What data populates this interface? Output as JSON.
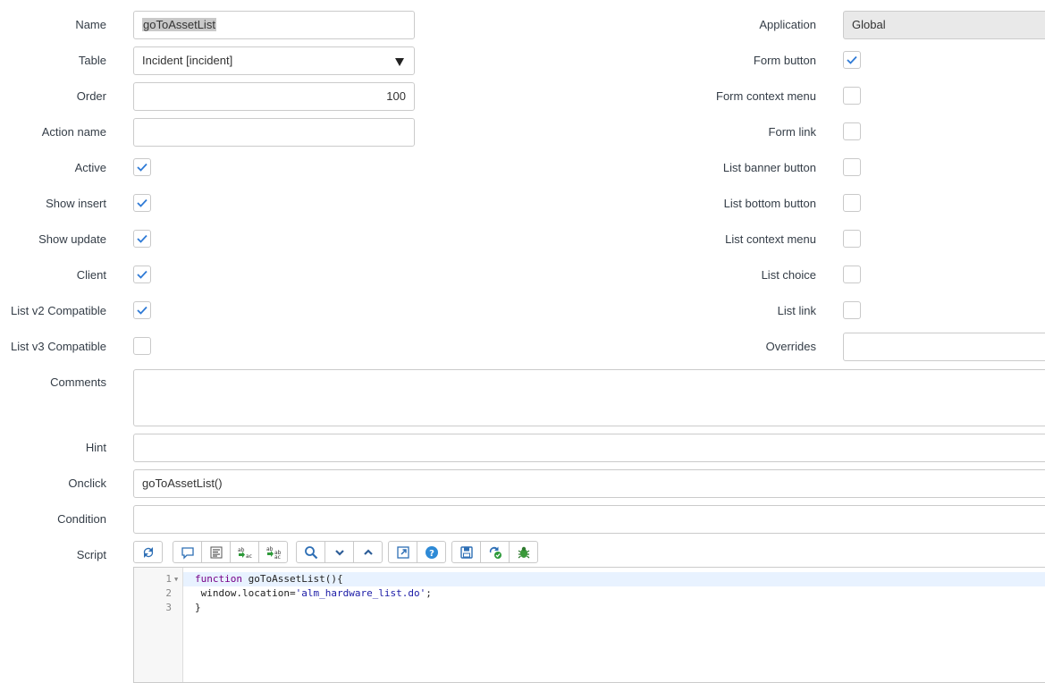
{
  "left_fields": {
    "name": {
      "label": "Name",
      "value": "goToAssetList"
    },
    "table": {
      "label": "Table",
      "value": "Incident [incident]"
    },
    "order": {
      "label": "Order",
      "value": "100"
    },
    "action_name": {
      "label": "Action name",
      "value": ""
    },
    "active": {
      "label": "Active",
      "checked": true
    },
    "show_insert": {
      "label": "Show insert",
      "checked": true
    },
    "show_update": {
      "label": "Show update",
      "checked": true
    },
    "client": {
      "label": "Client",
      "checked": true
    },
    "list_v2": {
      "label": "List v2 Compatible",
      "checked": true
    },
    "list_v3": {
      "label": "List v3 Compatible",
      "checked": false
    }
  },
  "right_fields": {
    "application": {
      "label": "Application",
      "value": "Global"
    },
    "form_button": {
      "label": "Form button",
      "checked": true
    },
    "form_context_menu": {
      "label": "Form context menu",
      "checked": false
    },
    "form_link": {
      "label": "Form link",
      "checked": false
    },
    "list_banner_button": {
      "label": "List banner button",
      "checked": false
    },
    "list_bottom_button": {
      "label": "List bottom button",
      "checked": false
    },
    "list_context_menu": {
      "label": "List context menu",
      "checked": false
    },
    "list_choice": {
      "label": "List choice",
      "checked": false
    },
    "list_link": {
      "label": "List link",
      "checked": false
    },
    "overrides": {
      "label": "Overrides",
      "value": ""
    }
  },
  "full_fields": {
    "comments": {
      "label": "Comments",
      "value": ""
    },
    "hint": {
      "label": "Hint",
      "value": ""
    },
    "onclick": {
      "label": "Onclick",
      "value": "goToAssetList()"
    },
    "condition": {
      "label": "Condition",
      "value": ""
    },
    "script": {
      "label": "Script"
    }
  },
  "toolbar_icons": [
    "toggle-syntax-icon",
    "comment-icon",
    "format-code-icon",
    "replace-icon",
    "replace-all-icon",
    "search-icon",
    "chevron-down-icon",
    "chevron-up-icon",
    "fullscreen-icon",
    "help-icon",
    "save-icon",
    "script-debug-icon",
    "bug-icon"
  ],
  "script": {
    "line_numbers": [
      "1",
      "2",
      "3"
    ],
    "line1": {
      "keyword": "function",
      "rest": " goToAssetList(){"
    },
    "line2": {
      "before": " window.location=",
      "string": "'alm_hardware_list.do'",
      "after": ";"
    },
    "line3": {
      "text": "}"
    }
  },
  "colors": {
    "check": "#2e7ad6",
    "border": "#cbcbcb",
    "readonly_bg": "#e9e9e9"
  }
}
